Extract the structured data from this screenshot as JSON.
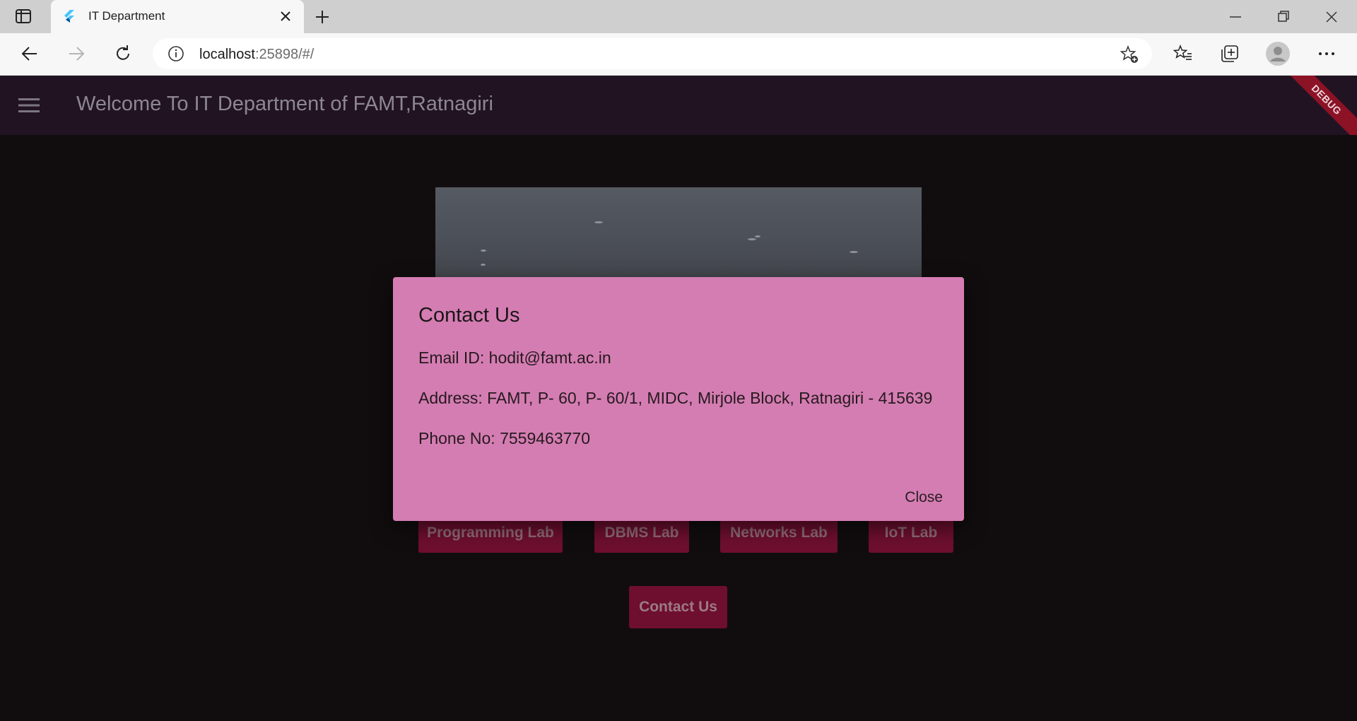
{
  "browser": {
    "tab_title": "IT Department",
    "url_host": "localhost",
    "url_rest": ":25898/#/"
  },
  "app": {
    "title": "Welcome To IT Department of FAMT,Ratnagiri",
    "debug_banner": "DEBUG",
    "labs": [
      "Programming Lab",
      "DBMS Lab",
      "Networks Lab",
      "IoT Lab"
    ],
    "contact_button": "Contact Us"
  },
  "dialog": {
    "title": "Contact Us",
    "email": "Email ID: hodit@famt.ac.in",
    "address": "Address: FAMT, P- 60, P- 60/1, MIDC, Mirjole Block, Ratnagiri - 415639",
    "phone": "Phone No: 7559463770",
    "close_label": "Close"
  },
  "colors": {
    "appbar": "#211322",
    "dialog_bg": "#d47db2",
    "button_bg": "#6e0f2f",
    "debug_banner": "#8c1226"
  },
  "icons": [
    "tab-actions-icon",
    "flutter-icon",
    "close-icon",
    "plus-icon",
    "minimize-icon",
    "restore-icon",
    "back-icon",
    "forward-icon",
    "refresh-icon",
    "info-icon",
    "favorite-add-icon",
    "favorites-icon",
    "collections-icon",
    "profile-icon",
    "more-icon",
    "menu-icon"
  ]
}
